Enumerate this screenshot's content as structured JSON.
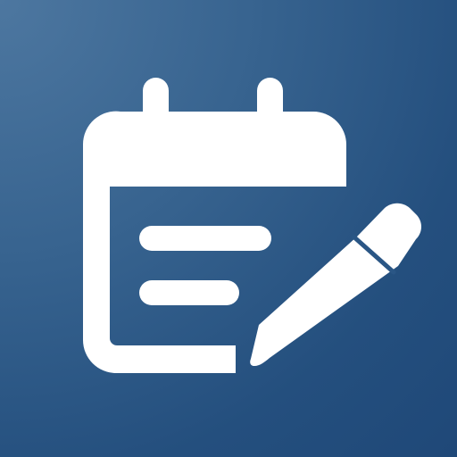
{
  "app_icon": {
    "icon": "calendar-note-edit-icon",
    "glyph_icons": [
      "calendar-icon",
      "note-lines-icon",
      "pencil-icon"
    ],
    "colors": {
      "background_light": "#4d77a0",
      "background_mid": "#37638f",
      "background_dark": "#1f4878",
      "glyph": "#ffffff"
    }
  }
}
